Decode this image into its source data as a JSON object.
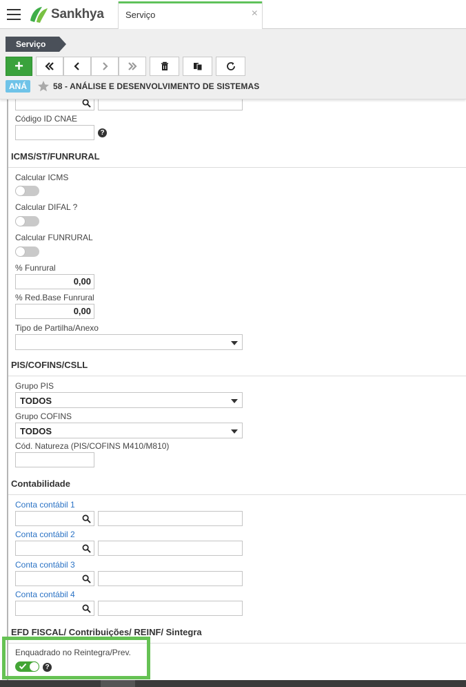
{
  "app": {
    "brand": "Sankhya",
    "tab_label": "Serviço",
    "tab_close": "×"
  },
  "toolbar": {
    "breadcrumb": "Serviço",
    "add_label": "+",
    "record_badge": "ANÁ",
    "record_title": "58 - ANÁLISE E DESENVOLVIMENTO DE SISTEMAS"
  },
  "form": {
    "cnae_label": "Código ID CNAE",
    "icms_section": "ICMS/ST/FUNRURAL",
    "calc_icms_label": "Calcular ICMS",
    "calc_difal_label": "Calcular DIFAL ?",
    "calc_funrural_label": "Calcular FUNRURAL",
    "pct_funrural_label": "% Funrural",
    "pct_funrural_value": "0,00",
    "red_base_label": "% Red.Base Funrural",
    "red_base_value": "0,00",
    "tipo_partilha_label": "Tipo de Partilha/Anexo",
    "tipo_partilha_value": "",
    "pis_section": "PIS/COFINS/CSLL",
    "grupo_pis_label": "Grupo PIS",
    "grupo_pis_value": "TODOS",
    "grupo_cofins_label": "Grupo COFINS",
    "grupo_cofins_value": "TODOS",
    "cod_natureza_label": "Cód. Natureza (PIS/COFINS M410/M810)",
    "contab_section": "Contabilidade",
    "conta1_label": "Conta contábil 1",
    "conta2_label": "Conta contábil 2",
    "conta3_label": "Conta contábil 3",
    "conta4_label": "Conta contábil 4",
    "efd_section": "EFD FISCAL/ Contribuições/ REINF/ Sintegra",
    "reintegra_label": "Enquadrado no Reintegra/Prev.",
    "help_glyph": "?"
  },
  "colors": {
    "accent_green": "#3aa23c",
    "link_blue": "#2b73c5",
    "badge_blue": "#6fc3e8",
    "highlight_green": "#66c254"
  }
}
